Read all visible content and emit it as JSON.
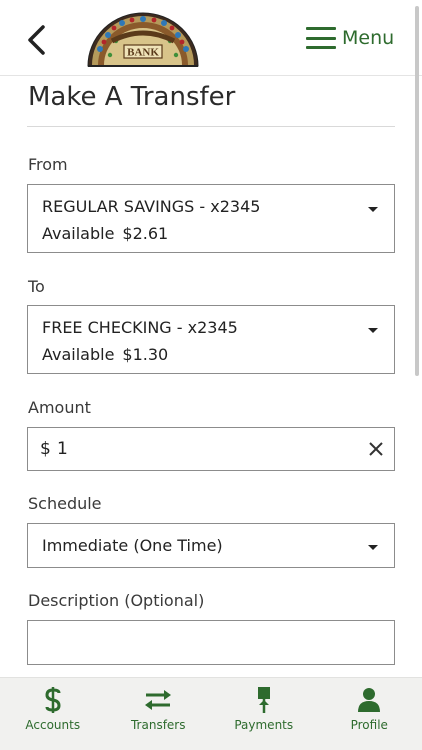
{
  "header": {
    "back_icon": "chevron-left-icon",
    "logo_text": "BANK",
    "menu_label": "Menu",
    "accent_color": "#2e6b2e"
  },
  "page": {
    "title": "Make A Transfer"
  },
  "from": {
    "label": "From",
    "account": "REGULAR SAVINGS - x2345",
    "available_label": "Available",
    "available_amount": "$2.61"
  },
  "to": {
    "label": "To",
    "account": "FREE CHECKING - x2345",
    "available_label": "Available",
    "available_amount": "$1.30"
  },
  "amount": {
    "label": "Amount",
    "currency": "$",
    "value": "1"
  },
  "schedule": {
    "label": "Schedule",
    "value": "Immediate (One Time)"
  },
  "description": {
    "label": "Description (Optional)",
    "value": ""
  },
  "tabs": [
    {
      "label": "Accounts",
      "icon": "dollar-icon"
    },
    {
      "label": "Transfers",
      "icon": "swap-arrows-icon"
    },
    {
      "label": "Payments",
      "icon": "payment-icon"
    },
    {
      "label": "Profile",
      "icon": "person-icon"
    }
  ]
}
